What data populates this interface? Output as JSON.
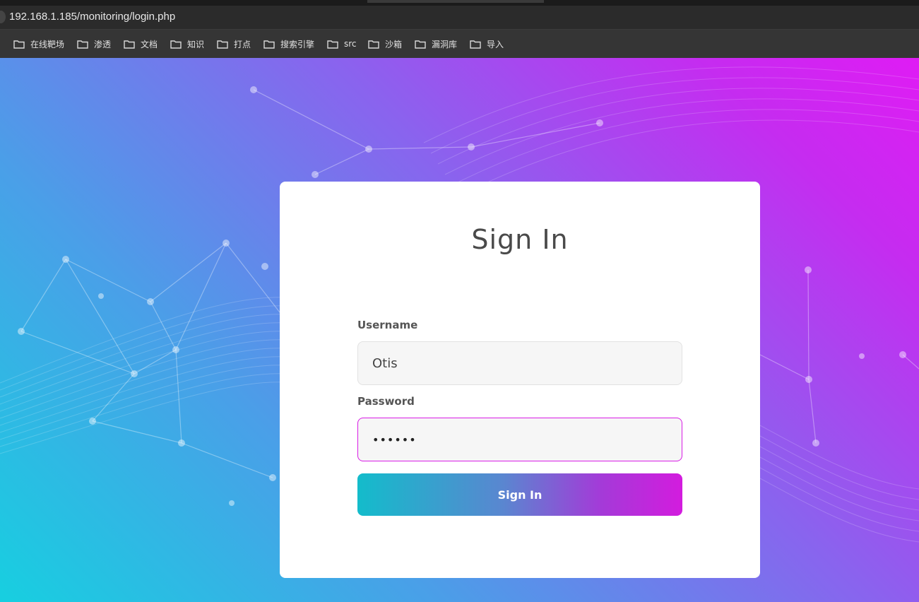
{
  "browser": {
    "url": "192.168.1.185/monitoring/login.php",
    "bookmarks": [
      {
        "label": "在线靶场",
        "icon": "folder-icon"
      },
      {
        "label": "渗透",
        "icon": "folder-icon"
      },
      {
        "label": "文档",
        "icon": "folder-icon"
      },
      {
        "label": "知识",
        "icon": "folder-icon"
      },
      {
        "label": "打点",
        "icon": "folder-icon"
      },
      {
        "label": "搜索引擎",
        "icon": "folder-icon"
      },
      {
        "label": "src",
        "icon": "folder-icon"
      },
      {
        "label": "沙箱",
        "icon": "folder-icon"
      },
      {
        "label": "漏洞库",
        "icon": "folder-icon"
      },
      {
        "label": "导入",
        "icon": "folder-icon"
      }
    ]
  },
  "login": {
    "title": "Sign In",
    "username_label": "Username",
    "username_value": "Otis",
    "password_label": "Password",
    "password_value": "••••••",
    "submit_label": "Sign In"
  },
  "colors": {
    "gradient_start": "#17cfe0",
    "gradient_end": "#df1cf4",
    "focus_border": "#d91ce6"
  }
}
